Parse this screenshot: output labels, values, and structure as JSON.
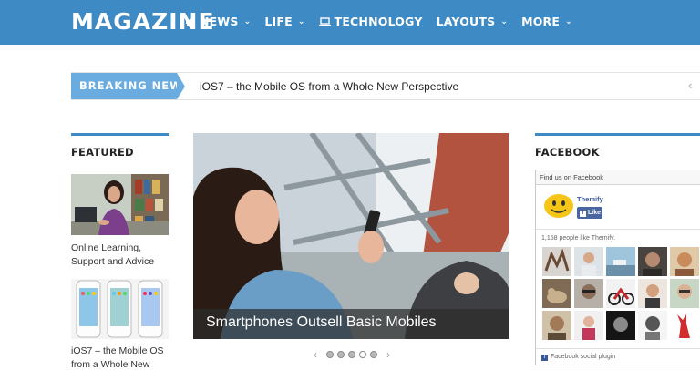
{
  "site": {
    "logo": "MAGAZINE"
  },
  "nav": {
    "items": [
      {
        "label": "NEWS",
        "icon": "megaphone-icon",
        "has_dropdown": true
      },
      {
        "label": "LIFE",
        "icon": null,
        "has_dropdown": true
      },
      {
        "label": "TECHNOLOGY",
        "icon": "laptop-icon",
        "has_dropdown": false
      },
      {
        "label": "LAYOUTS",
        "icon": null,
        "has_dropdown": true
      },
      {
        "label": "MORE",
        "icon": null,
        "has_dropdown": true
      }
    ]
  },
  "breaking": {
    "label": "BREAKING NEWS",
    "headline": "iOS7 – the Mobile OS from a Whole New Perspective"
  },
  "featured": {
    "title": "FEATURED",
    "items": [
      {
        "caption": "Online Learning, Support and Advice"
      },
      {
        "caption": "iOS7 – the Mobile OS from a Whole New"
      }
    ]
  },
  "slider": {
    "caption": "Smartphones Outsell Basic Mobiles",
    "slide_count": 5,
    "active_index": 0
  },
  "facebook": {
    "title": "FACEBOOK",
    "find_us": "Find us on Facebook",
    "page_name": "Themify",
    "like_label": "Like",
    "fans_text": "1,158 people like Themify.",
    "plugin_label": "Facebook social plugin"
  },
  "colors": {
    "brand_blue": "#3d8ac4",
    "breaking_blue": "#6aace0",
    "facebook_blue": "#3b5998"
  }
}
